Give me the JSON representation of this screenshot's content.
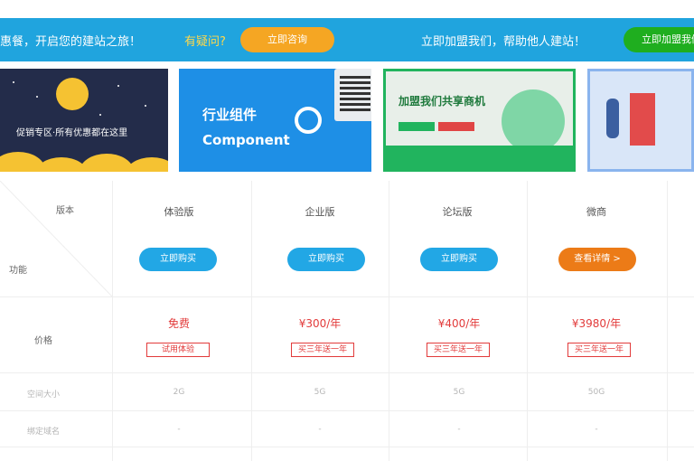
{
  "promo": {
    "left_text": "惠餐，开启您的建站之旅！",
    "ask_text": "有疑问?",
    "left_button": "立即咨询",
    "right_text": "立即加盟我们，帮助他人建站！",
    "right_button": "立即加盟我们"
  },
  "thumbnails": [
    {
      "name": "promo-zone",
      "caption": "促销专区·所有优惠都在这里"
    },
    {
      "name": "industry-components",
      "title": "行业组件",
      "subtitle": "Component"
    },
    {
      "name": "join-us",
      "title": "加盟我们共享商机"
    },
    {
      "name": "feature-4",
      "title": ""
    }
  ],
  "table": {
    "header_version": "版本",
    "header_function": "功能",
    "row_price_label": "价格",
    "row_space_label": "空间大小",
    "row_domain_label": "绑定域名",
    "plans": [
      {
        "name": "体验版",
        "button": "立即购买",
        "price": "免费",
        "tag": "试用体验",
        "space": "2G",
        "domain": "-"
      },
      {
        "name": "企业版",
        "button": "立即购买",
        "price": "¥300/年",
        "tag": "买三年送一年",
        "space": "5G",
        "domain": "-"
      },
      {
        "name": "论坛版",
        "button": "立即购买",
        "price": "¥400/年",
        "tag": "买三年送一年",
        "space": "5G",
        "domain": "-"
      },
      {
        "name": "微商",
        "button": "查看详情 >",
        "price": "¥3980/年",
        "tag": "买三年送一年",
        "space": "50G",
        "domain": "-"
      }
    ]
  },
  "colors": {
    "banner": "#20a4de",
    "accent_orange": "#f5a623",
    "accent_green": "#1fae1f",
    "button_blue": "#22a7e5",
    "button_orange": "#ec7b17",
    "price_red": "#e23b3b"
  }
}
